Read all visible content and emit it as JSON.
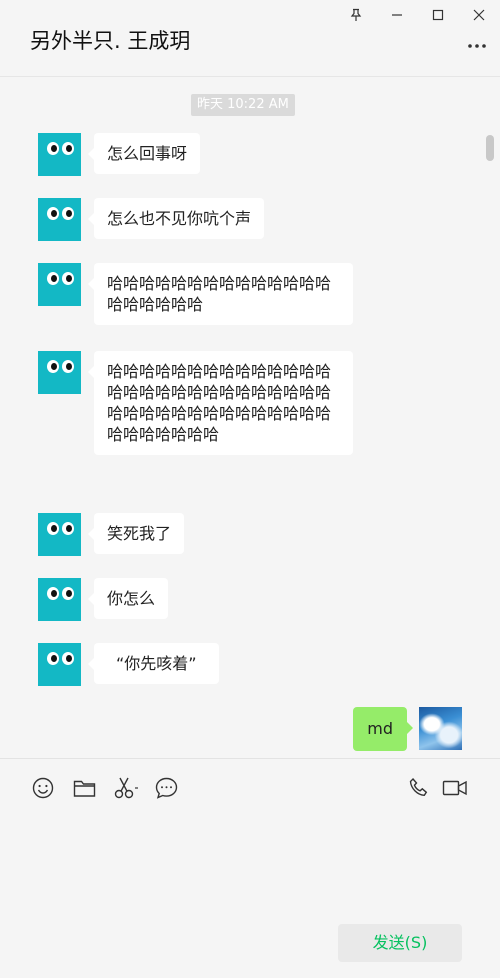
{
  "window": {
    "title": "另外半只. 王成玥",
    "controls": [
      "pin-icon",
      "minimize-icon",
      "maximize-icon",
      "close-icon"
    ],
    "more_icon": "more-icon"
  },
  "chat": {
    "timestamp": "昨天 10:22 AM",
    "messages": [
      {
        "from": "contact",
        "text": "怎么回事呀"
      },
      {
        "from": "contact",
        "text": "怎么也不见你吭个声"
      },
      {
        "from": "contact",
        "text": "哈哈哈哈哈哈哈哈哈哈哈哈哈哈哈哈哈哈哈哈"
      },
      {
        "from": "contact",
        "text": "哈哈哈哈哈哈哈哈哈哈哈哈哈哈哈哈哈哈哈哈哈哈哈哈哈哈哈哈哈哈哈哈哈哈哈哈哈哈哈哈哈哈哈哈哈哈哈哈哈"
      },
      {
        "from": "contact",
        "text": "笑死我了"
      },
      {
        "from": "contact",
        "text": "你怎么"
      },
      {
        "from": "contact",
        "text": "“你先咳着”"
      },
      {
        "from": "me",
        "text": "md"
      }
    ]
  },
  "toolbar": {
    "left": [
      "emoji-icon",
      "folder-icon",
      "scissors-icon",
      "chat-history-icon"
    ],
    "right": [
      "phone-icon",
      "video-icon"
    ]
  },
  "send_label": "发送(S)",
  "colors": {
    "background": "#f5f5f5",
    "avatar": "#13b8c5",
    "my_bubble": "#95ec69",
    "send_text": "#07c160"
  }
}
